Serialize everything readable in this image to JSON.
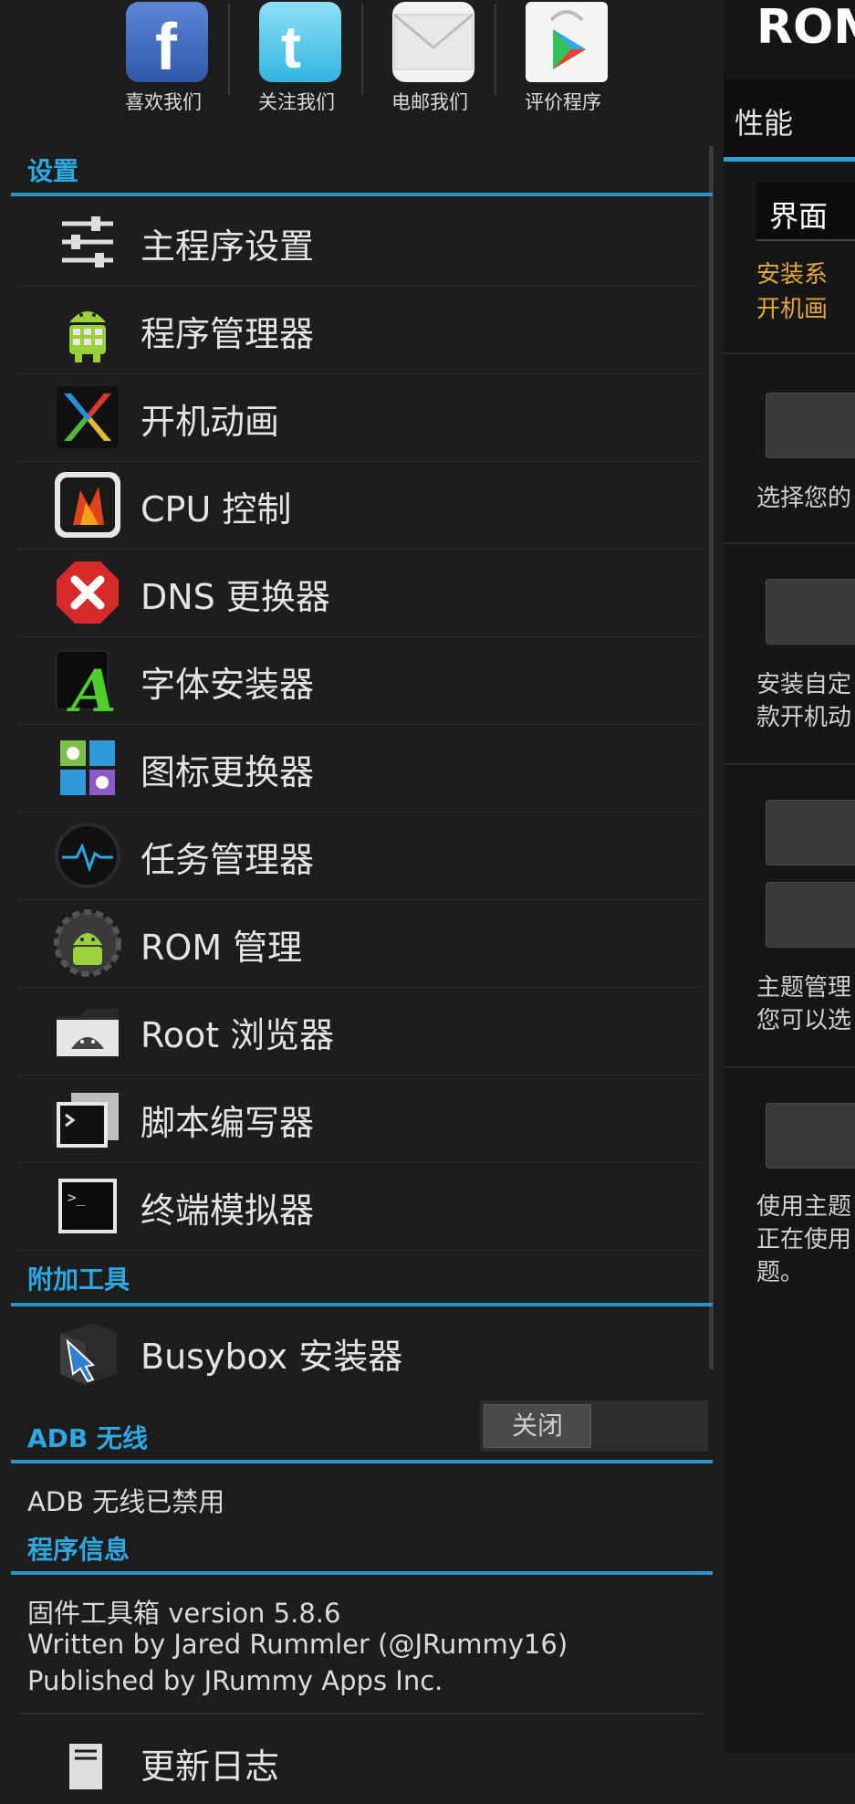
{
  "right_panel": {
    "title": "ROM",
    "tab": "性能",
    "spinner_value": "界面",
    "orange_line1": "安装系",
    "orange_line2": "开机画",
    "desc1": "选择您的",
    "desc2_line1": "安装自定",
    "desc2_line2": "款开机动",
    "desc3_line1": "主题管理",
    "desc3_line2": "您可以选",
    "desc4_line1": "使用主题",
    "desc4_line2": "正在使用",
    "desc4_line3": "题。"
  },
  "social": [
    {
      "label": "喜欢我们",
      "icon": "facebook-icon"
    },
    {
      "label": "关注我们",
      "icon": "twitter-icon"
    },
    {
      "label": "电邮我们",
      "icon": "email-icon"
    },
    {
      "label": "评价程序",
      "icon": "play-store-icon"
    }
  ],
  "sections": {
    "settings": "设置",
    "extra_tools": "附加工具",
    "adb_wireless": "ADB 无线",
    "app_info": "程序信息"
  },
  "menu": [
    {
      "label": "主程序设置",
      "icon": "sliders-icon"
    },
    {
      "label": "程序管理器",
      "icon": "android-icon"
    },
    {
      "label": "开机动画",
      "icon": "boot-animation-icon"
    },
    {
      "label": "CPU 控制",
      "icon": "cpu-icon"
    },
    {
      "label": "DNS 更换器",
      "icon": "dns-icon"
    },
    {
      "label": "字体安装器",
      "icon": "font-icon"
    },
    {
      "label": "图标更换器",
      "icon": "icon-changer-icon"
    },
    {
      "label": "任务管理器",
      "icon": "task-manager-icon"
    },
    {
      "label": "ROM 管理",
      "icon": "rom-gear-icon"
    },
    {
      "label": "Root 浏览器",
      "icon": "root-browser-icon"
    },
    {
      "label": "脚本编写器",
      "icon": "script-icon"
    },
    {
      "label": "终端模拟器",
      "icon": "terminal-icon"
    }
  ],
  "extra": [
    {
      "label": "Busybox 安装器",
      "icon": "busybox-icon"
    }
  ],
  "adb": {
    "toggle": "关闭",
    "status": "ADB 无线已禁用"
  },
  "app_info": {
    "line1": "固件工具箱 version 5.8.6",
    "line2": "Written by Jared Rummler (@JRummy16)",
    "line3": "Published by JRummy Apps Inc.",
    "changelog": "更新日志"
  },
  "colors": {
    "accent": "#2ea8e0",
    "orange": "#e0a93e",
    "background": "#1d1d1d"
  }
}
